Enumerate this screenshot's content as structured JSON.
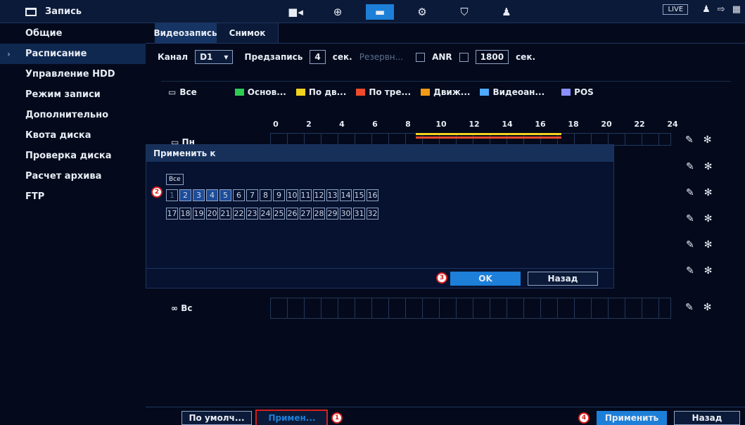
{
  "header": {
    "title": "Запись",
    "live": "LIVE",
    "icons": [
      "camera-icon",
      "globe-icon",
      "storage-icon",
      "gears-icon",
      "shield-icon",
      "user-settings-icon"
    ]
  },
  "sidebar": {
    "items": [
      {
        "label": "Общие"
      },
      {
        "label": "Расписание",
        "active": true
      },
      {
        "label": "Управление HDD"
      },
      {
        "label": "Режим записи"
      },
      {
        "label": "Дополнительно"
      },
      {
        "label": "Квота диска"
      },
      {
        "label": "Проверка диска"
      },
      {
        "label": "Расчет архива"
      },
      {
        "label": "FTP"
      }
    ]
  },
  "tabs": [
    "Видеозапись",
    "Снимок"
  ],
  "settings": {
    "channel_label": "Канал",
    "channel_value": "D1",
    "prerecord_label": "Предзапись",
    "prerecord_value": "4",
    "sec": "сек.",
    "backup_label": "Резервн...",
    "anr_label": "ANR",
    "anr_value": "1800",
    "anr_unit": "сек."
  },
  "legend": {
    "all": "Все",
    "items": [
      {
        "label": "Основ...",
        "color": "#2ecc52"
      },
      {
        "label": "По дв...",
        "color": "#f2d21e"
      },
      {
        "label": "По тре...",
        "color": "#f04a2c"
      },
      {
        "label": "Движ...",
        "color": "#f29a14"
      },
      {
        "label": "Видеоан...",
        "color": "#4ea9ff"
      },
      {
        "label": "POS",
        "color": "#8a8fff"
      }
    ]
  },
  "axis": [
    "0",
    "2",
    "4",
    "6",
    "8",
    "10",
    "12",
    "14",
    "16",
    "18",
    "20",
    "22",
    "24"
  ],
  "days": {
    "mon": "Пн",
    "sun": "Вс"
  },
  "dialog": {
    "title": "Применить к",
    "all_label": "Все",
    "channels_row1": [
      "1",
      "2",
      "3",
      "4",
      "5",
      "6",
      "7",
      "8",
      "9",
      "10",
      "11",
      "12",
      "13",
      "14",
      "15",
      "16"
    ],
    "channels_row2": [
      "17",
      "18",
      "19",
      "20",
      "21",
      "22",
      "23",
      "24",
      "25",
      "26",
      "27",
      "28",
      "29",
      "30",
      "31",
      "32"
    ],
    "ok": "OK",
    "back": "Назад"
  },
  "footer": {
    "default": "По умолч...",
    "copy": "Примен...",
    "apply": "Применить",
    "back": "Назад"
  },
  "badges": [
    "1",
    "2",
    "3",
    "4"
  ]
}
